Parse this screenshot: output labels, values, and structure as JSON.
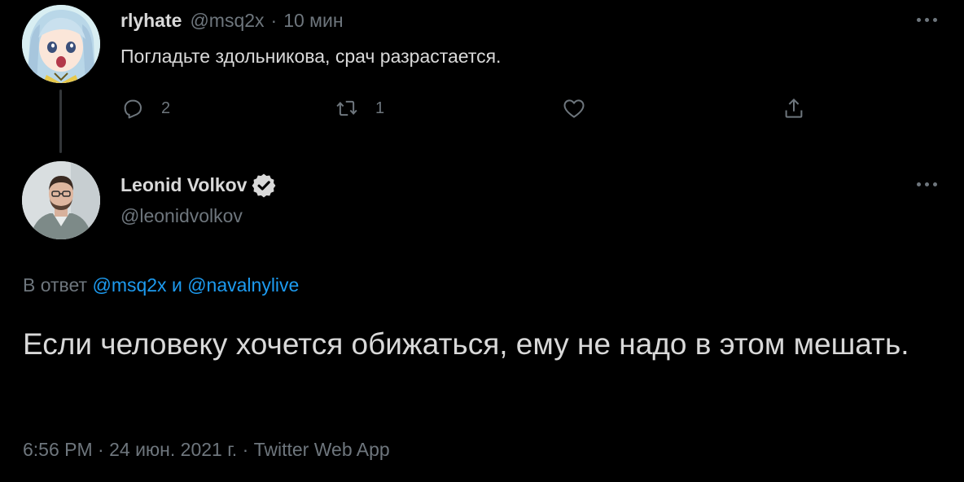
{
  "parent_tweet": {
    "display_name": "rlyhate",
    "handle": "@msq2x",
    "separator": "·",
    "time": "10 мин",
    "text": "Погладьте здольникова, срач разрастается.",
    "actions": {
      "reply_count": "2",
      "retweet_count": "1",
      "like_count": "",
      "share_count": ""
    }
  },
  "main_tweet": {
    "display_name": "Leonid Volkov",
    "verified": true,
    "handle": "@leonidvolkov",
    "reply_prefix": "В ответ",
    "reply_mention_1": "@msq2x",
    "reply_conjunction": "и",
    "reply_mention_2": "@navalnylive",
    "text": "Если человеку хочется обижаться, ему не надо в этом мешать.",
    "meta": "6:56 PM · 24 июн. 2021 г. · Twitter Web App"
  },
  "colors": {
    "background": "#000000",
    "text_primary": "#d9d9d9",
    "text_secondary": "#6e767d",
    "link": "#1d9bf0",
    "thread_line": "#333639"
  },
  "icons": {
    "reply": "reply-icon",
    "retweet": "retweet-icon",
    "like": "heart-icon",
    "share": "share-icon",
    "more": "more-icon",
    "verified": "verified-badge-icon"
  }
}
